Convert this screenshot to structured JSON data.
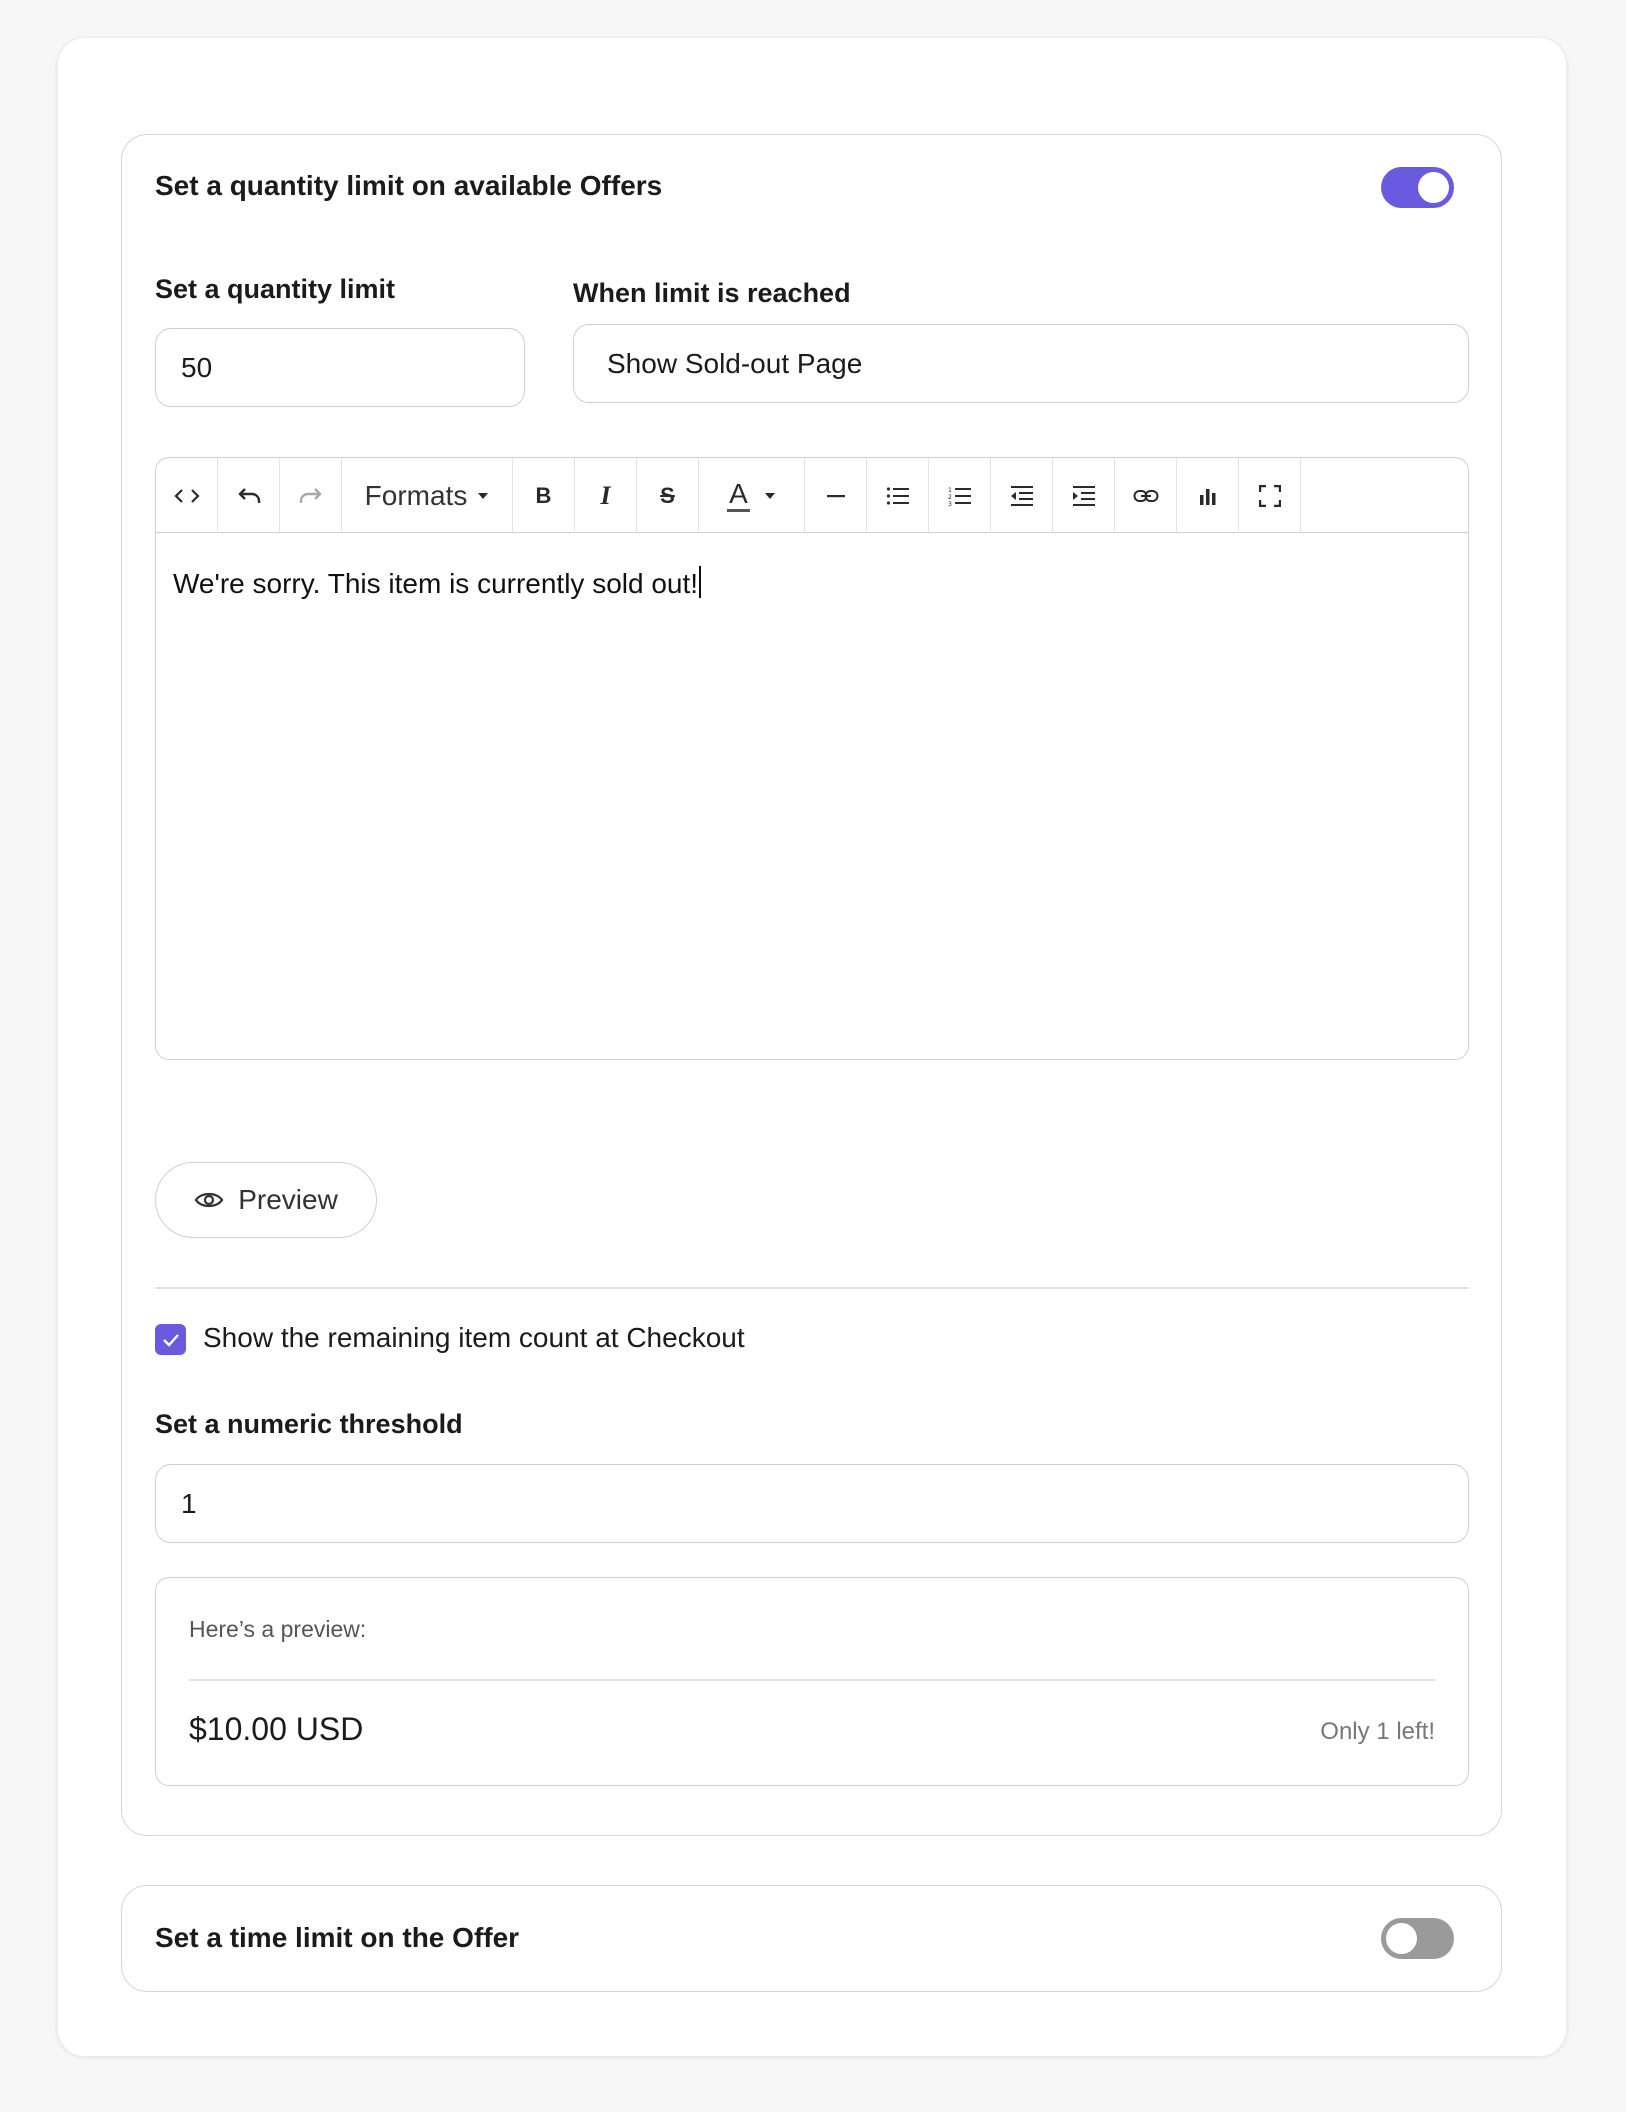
{
  "quantity_section": {
    "title": "Set a quantity limit on available Offers",
    "enabled": true,
    "quantity_label": "Set a quantity limit",
    "quantity_value": "50",
    "when_limit_label": "When limit is reached",
    "when_limit_value": "Show Sold-out Page",
    "toolbar": {
      "formats_label": "Formats",
      "bold": "B",
      "italic": "I",
      "strike": "S",
      "text_color": "A"
    },
    "editor_text": "We're sorry. This item is currently sold out!",
    "preview_button": "Preview",
    "show_remaining_checked": true,
    "show_remaining_label": "Show the remaining item count at Checkout",
    "threshold_label": "Set a numeric threshold",
    "threshold_value": "1",
    "preview_hint": "Here’s a preview:",
    "preview_price": "$10.00 USD",
    "preview_left": "Only 1 left!"
  },
  "time_section": {
    "title": "Set a time limit on the Offer",
    "enabled": false
  },
  "colors": {
    "accent": "#6a5ae0",
    "toggle_off": "#9a9a9a"
  },
  "icons": [
    "code-icon",
    "undo-icon",
    "redo-icon",
    "chevron-down-icon",
    "bold-icon",
    "italic-icon",
    "strikethrough-icon",
    "text-color-icon",
    "horizontal-rule-icon",
    "bullet-list-icon",
    "numbered-list-icon",
    "outdent-icon",
    "indent-icon",
    "link-icon",
    "chart-icon",
    "fullscreen-icon",
    "eye-icon",
    "check-icon"
  ]
}
